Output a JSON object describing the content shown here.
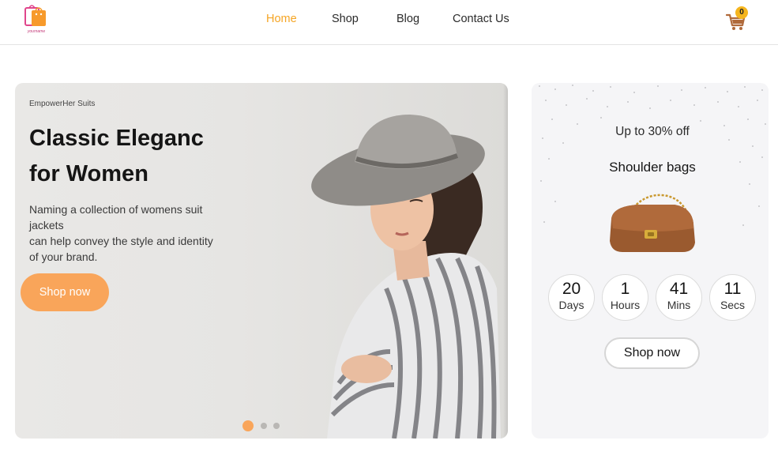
{
  "brand": {
    "logo_text": "yourname"
  },
  "nav": {
    "items": [
      {
        "label": "Home",
        "active": true
      },
      {
        "label": "Shop",
        "active": false
      },
      {
        "label": "Blog",
        "active": false
      },
      {
        "label": "Contact Us",
        "active": false
      }
    ]
  },
  "cart": {
    "count": "0"
  },
  "hero": {
    "eyebrow": "EmpowerHer Suits",
    "headline_line1": "Classic Eleganc",
    "headline_line2": "for Women",
    "description_line1": "Naming a collection of womens suit",
    "description_line2": "jackets",
    "description_line3": "can help convey the style and identity",
    "description_line4": "of your brand.",
    "cta_label": "Shop now",
    "slides": {
      "count": 3,
      "active_index": 0
    }
  },
  "promo": {
    "subtitle": "Up to 30% off",
    "title": "Shoulder bags",
    "countdown": [
      {
        "value": "20",
        "unit": "Days"
      },
      {
        "value": "1",
        "unit": "Hours"
      },
      {
        "value": "41",
        "unit": "Mins"
      },
      {
        "value": "11",
        "unit": "Secs"
      }
    ],
    "cta_label": "Shop now"
  },
  "colors": {
    "accent": "#f5a524",
    "button_orange": "#f9a55a",
    "badge": "#f5b51e",
    "cart_icon": "#b06a3b"
  }
}
